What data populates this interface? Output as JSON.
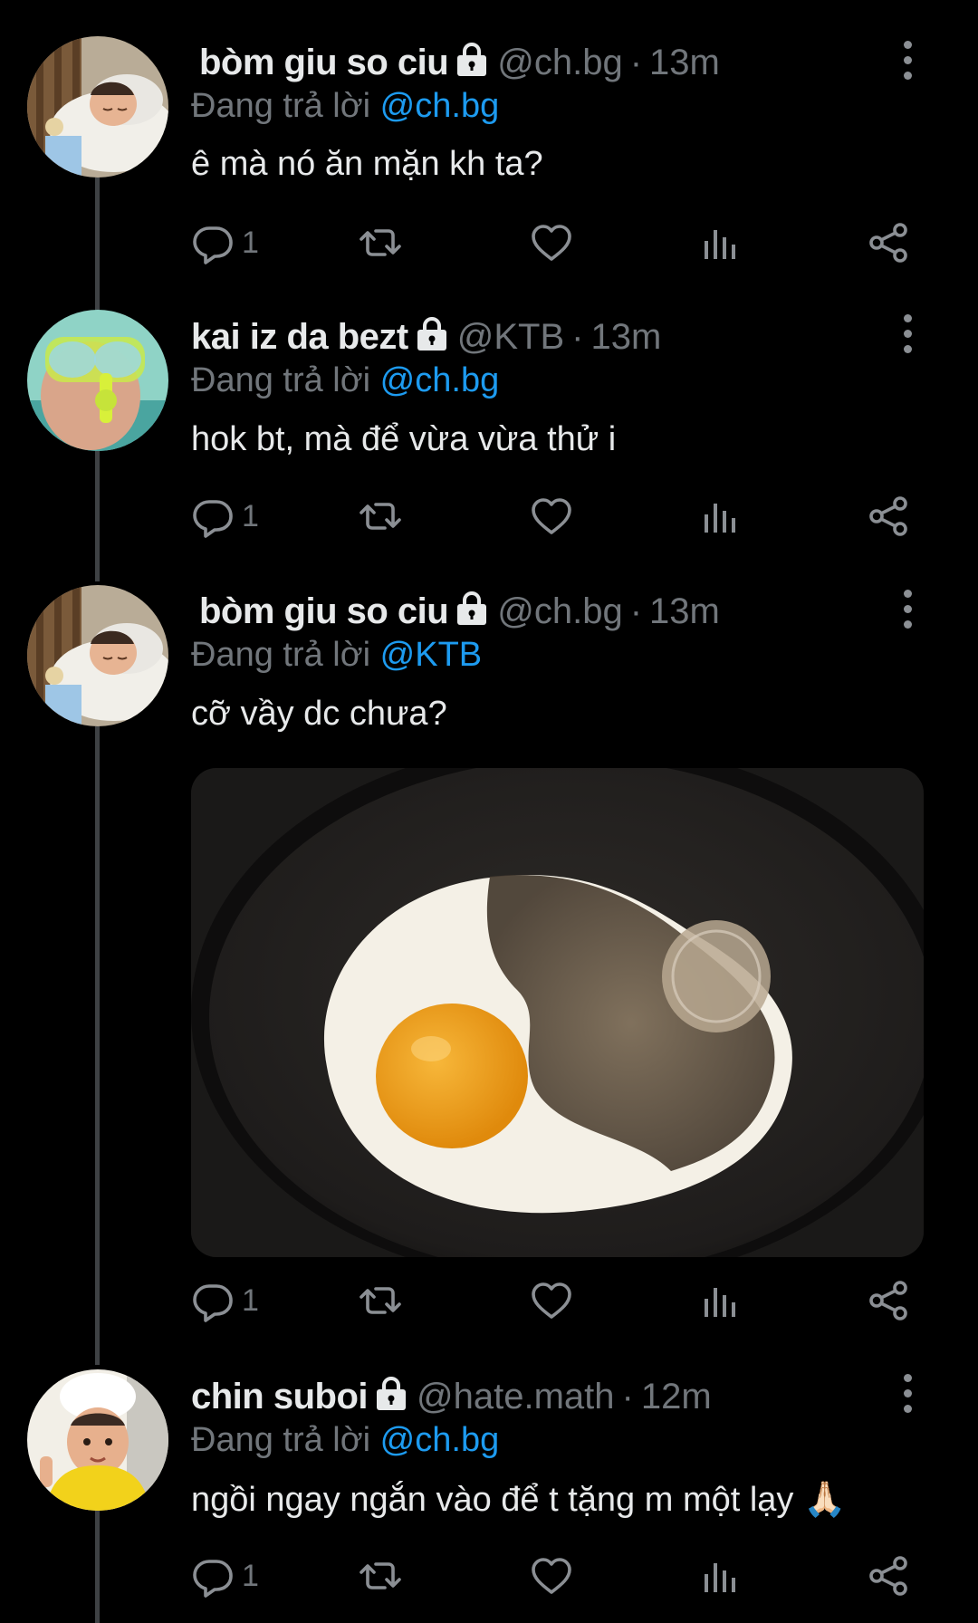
{
  "replying_prefix": "Đang trả lời",
  "tweets": [
    {
      "name": "bòm giu so ciu",
      "handle": "@ch.bg",
      "sep": "·",
      "time": "13m",
      "replying_to": "@ch.bg",
      "text": "ê mà nó ăn mặn kh ta?",
      "reply_count": "1",
      "avatar": "baby-sleeping"
    },
    {
      "name": "kai iz da bezt",
      "handle": "@KTB",
      "sep": "·",
      "time": "13m",
      "replying_to": "@ch.bg",
      "text": "hok bt, mà để vừa vừa thử i",
      "reply_count": "1",
      "avatar": "child-snorkel-mask"
    },
    {
      "name": "bòm giu so ciu",
      "handle": "@ch.bg",
      "sep": "·",
      "time": "13m",
      "replying_to": "@KTB",
      "text": "cỡ vầy dc chưa?",
      "reply_count": "1",
      "avatar": "baby-sleeping",
      "media": "fried-egg-with-pepper-in-pan"
    },
    {
      "name": "chin suboi",
      "handle": "@hate.math",
      "sep": "·",
      "time": "12m",
      "replying_to": "@ch.bg",
      "text": "ngồi ngay ngắn vào để t tặng m một lạy 🙏🏻",
      "reply_count": "1",
      "avatar": "child-chef-hat"
    }
  ],
  "icons": {
    "lock": "lock-icon",
    "more": "more-vertical-icon",
    "reply": "reply-icon",
    "retweet": "retweet-icon",
    "like": "heart-icon",
    "views": "views-icon",
    "share": "share-icon"
  },
  "colors": {
    "background": "#000000",
    "text": "#e7e9ea",
    "secondary": "#71767b",
    "mention": "#1d9bf0"
  }
}
